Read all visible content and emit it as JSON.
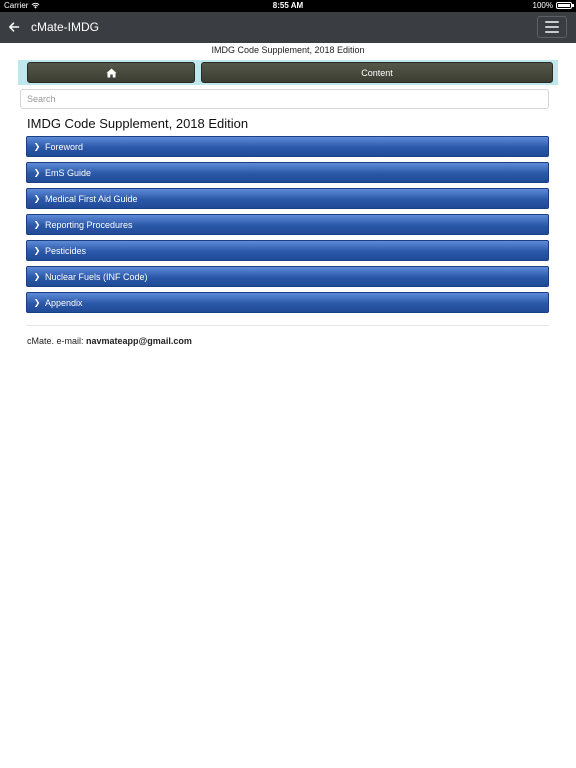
{
  "status_bar": {
    "carrier": "Carrier",
    "time": "8:55 AM",
    "battery": "100%",
    "battery_level": 1.0
  },
  "nav": {
    "back_icon": "arrow-left-icon",
    "title": "cMate-IMDG",
    "menu_icon": "hamburger-menu-icon"
  },
  "supplement_title": "IMDG Code Supplement, 2018 Edition",
  "toolbar": {
    "home_icon": "home-icon",
    "content_label": "Content",
    "button_color": "#4a4c40",
    "background_color": "#bfe7ee"
  },
  "search": {
    "placeholder": "Search",
    "value": ""
  },
  "page_title": "IMDG Code Supplement, 2018 Edition",
  "sections": [
    {
      "label": "Foreword"
    },
    {
      "label": "EmS Guide"
    },
    {
      "label": "Medical First Aid Guide"
    },
    {
      "label": "Reporting Procedures"
    },
    {
      "label": "Pesticides"
    },
    {
      "label": "Nuclear Fuels (INF Code)"
    },
    {
      "label": "Appendix"
    }
  ],
  "section_chevron": "chevron-right-icon",
  "accent_color": "#2b58a8",
  "footer": {
    "prefix": "cMate. e-mail: ",
    "email": "navmateapp@gmail.com"
  }
}
